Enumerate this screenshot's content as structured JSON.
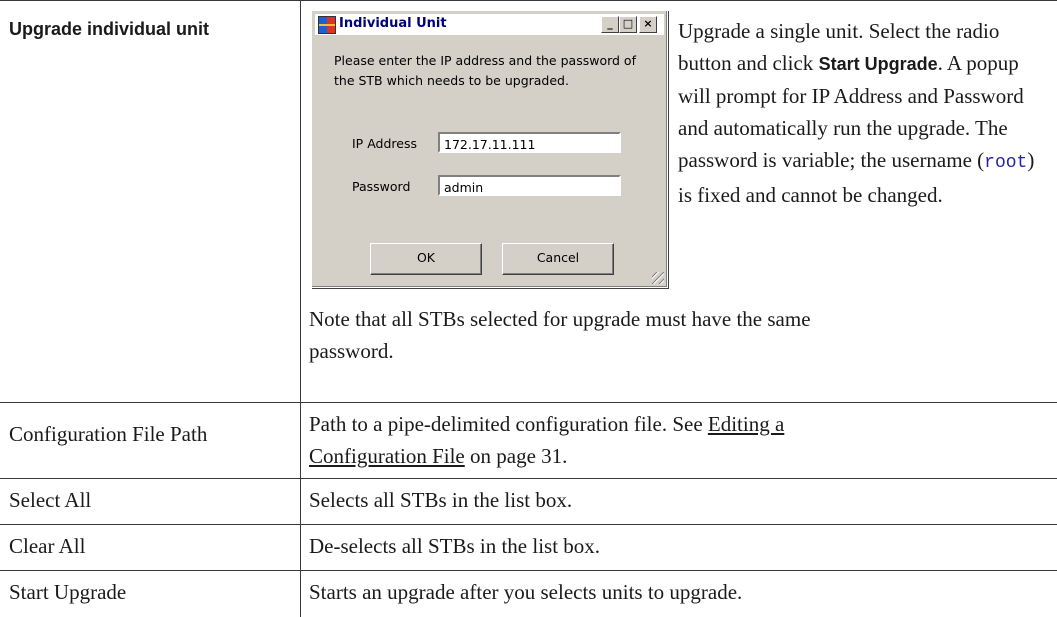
{
  "rows": [
    {
      "term": "Upgrade individual unit",
      "desc_parts": {
        "p1": "Upgrade a single unit. Select the radio button and click ",
        "start_upgrade_kw": "Start Upgrade",
        "p2": ". A popup will prompt for IP Address and Password and automatically run the upgrade. The password is variable; the username (",
        "root_kw": "root",
        "p3": ") is fixed and cannot be changed."
      },
      "note": "Note that all STBs selected for upgrade must have the same password."
    },
    {
      "term": "Configuration File Path",
      "desc_before": "Path to a pipe-delimited configuration file. See ",
      "link_text": "Editing a Configuration File",
      "desc_after": " on page 31."
    },
    {
      "term": "Select All",
      "desc": "Selects all STBs in the list box."
    },
    {
      "term": "Clear All",
      "desc": "De-selects all STBs in the list box."
    },
    {
      "term": "Start Upgrade",
      "desc": "Starts an upgrade after you selects units to upgrade."
    }
  ],
  "dialog": {
    "title": "Individual Unit",
    "titlebar_buttons": {
      "minimize": "_",
      "maximize": "□",
      "close": "×"
    },
    "prompt": "Please enter the IP address and the password of the STB which needs to be upgraded.",
    "ip_label": "IP Address",
    "ip_value": "172.17.11.111",
    "password_label": "Password",
    "password_value": "admin",
    "ok_label": "OK",
    "cancel_label": "Cancel"
  }
}
